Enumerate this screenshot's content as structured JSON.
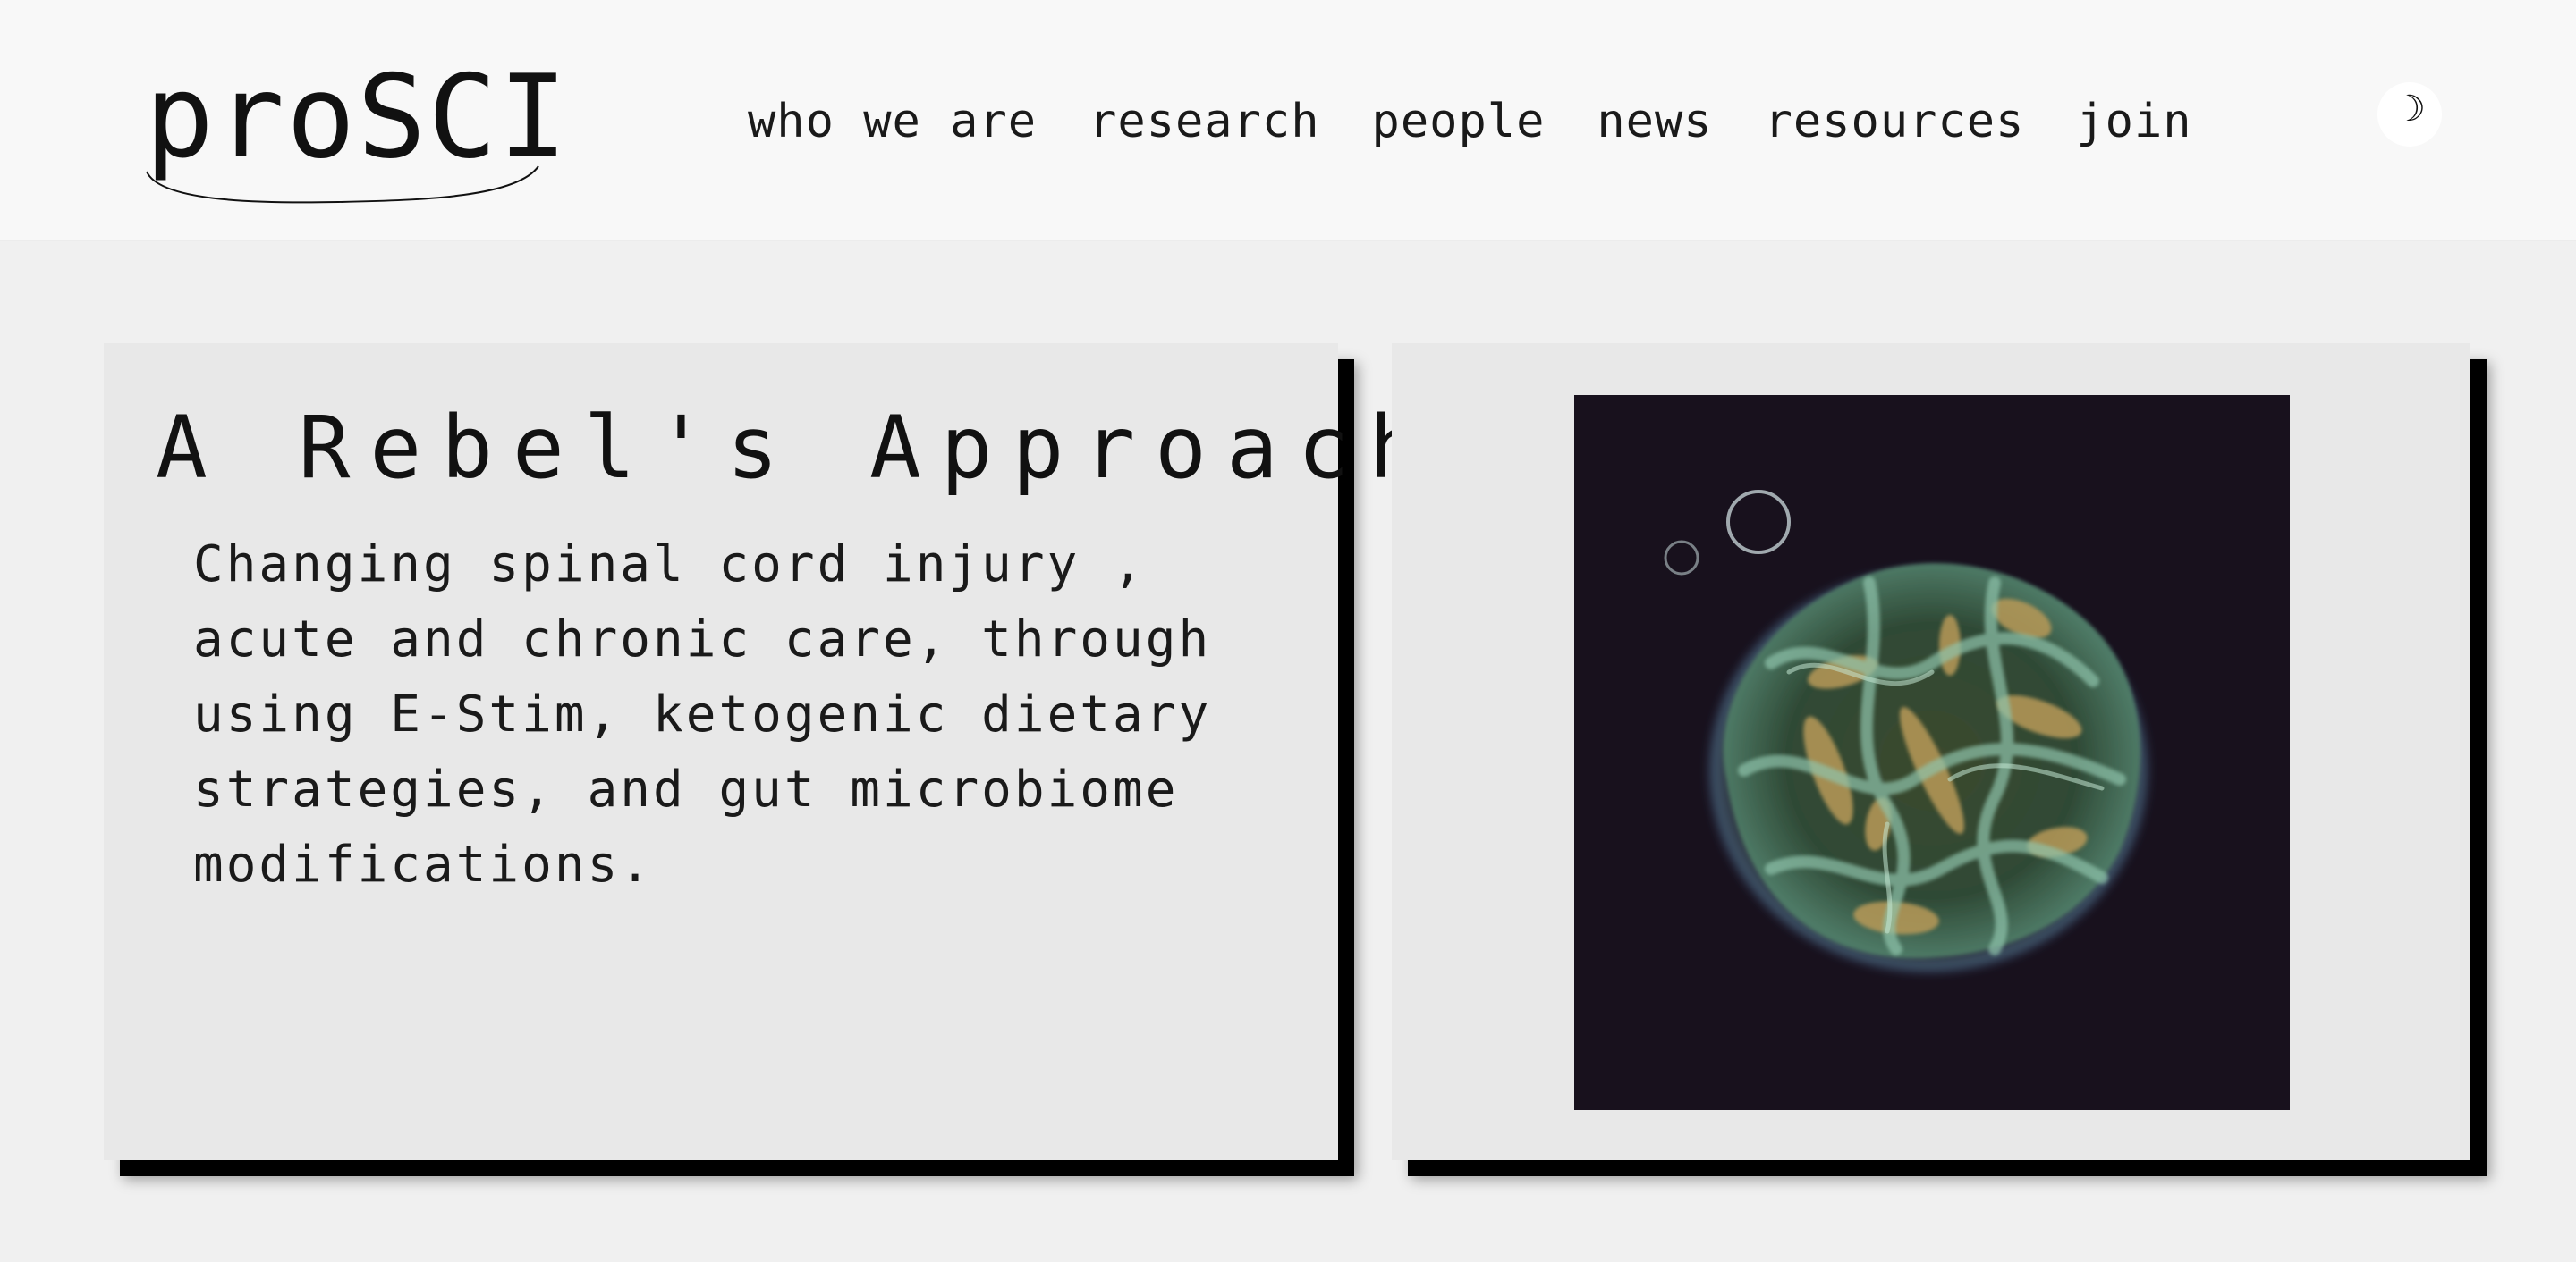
{
  "header": {
    "logo_text": "proSCI",
    "nav": [
      {
        "label": "who we are"
      },
      {
        "label": "research"
      },
      {
        "label": "people"
      },
      {
        "label": "news"
      },
      {
        "label": "resources"
      },
      {
        "label": "join"
      }
    ],
    "theme_toggle_icon": "moon-icon",
    "theme_toggle_glyph": "☽"
  },
  "hero": {
    "title": "A Rebel's Approach",
    "body": "Changing spinal cord injury , acute and chronic care, through using E-Stim, ketogenic dietary strategies, and gut microbiome modifications."
  },
  "colors": {
    "page_background": "#f0f0f0",
    "header_background": "#f8f8f8",
    "card_background": "#e8e8e8",
    "card_shadow": "#000000",
    "image_background": "#18111d",
    "text": "#111111"
  }
}
